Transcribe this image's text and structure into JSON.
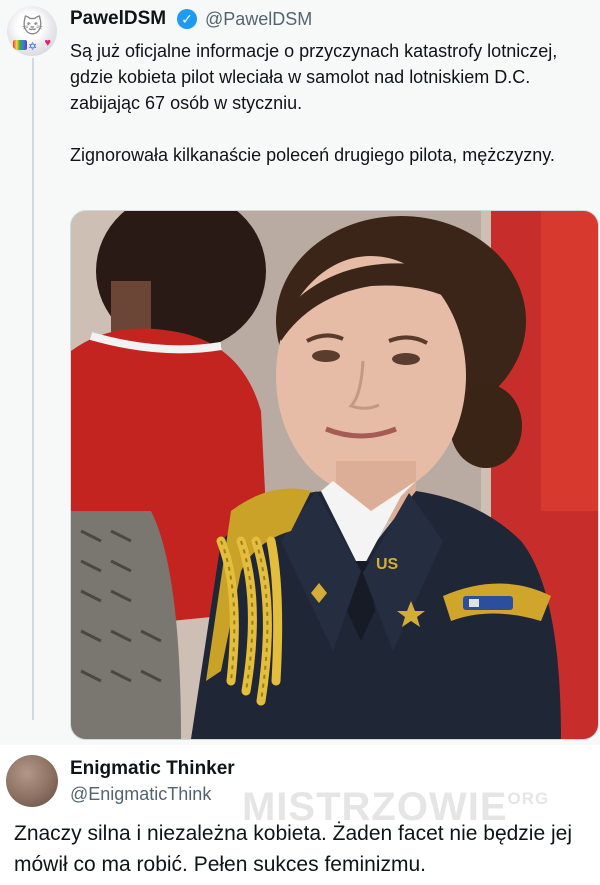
{
  "tweet": {
    "display_name": "PawelDSM",
    "verified_icon": "verified-badge-icon",
    "handle": "@PawelDSM",
    "paragraph_1": "Są już oficjalne informacje o przyczynach katastrofy lotniczej, gdzie kobieta pilot wleciała w samolot nad lotniskiem D.C. zabijając 67 osób w styczniu.",
    "paragraph_2": "Zignorowała kilkanaście poleceń drugiego pilota, mężczyzny.",
    "accent_color": "#1d9bf0"
  },
  "reply": {
    "display_name": "Enigmatic Thinker",
    "handle": "@EnigmaticThink",
    "text": "Znaczy silna i niezależna kobieta. Żaden facet nie będzie jej mówił co ma robić. Pełen sukces feminizmu."
  },
  "watermark": {
    "main": "MISTRZOWIE",
    "suffix": "ORG"
  }
}
